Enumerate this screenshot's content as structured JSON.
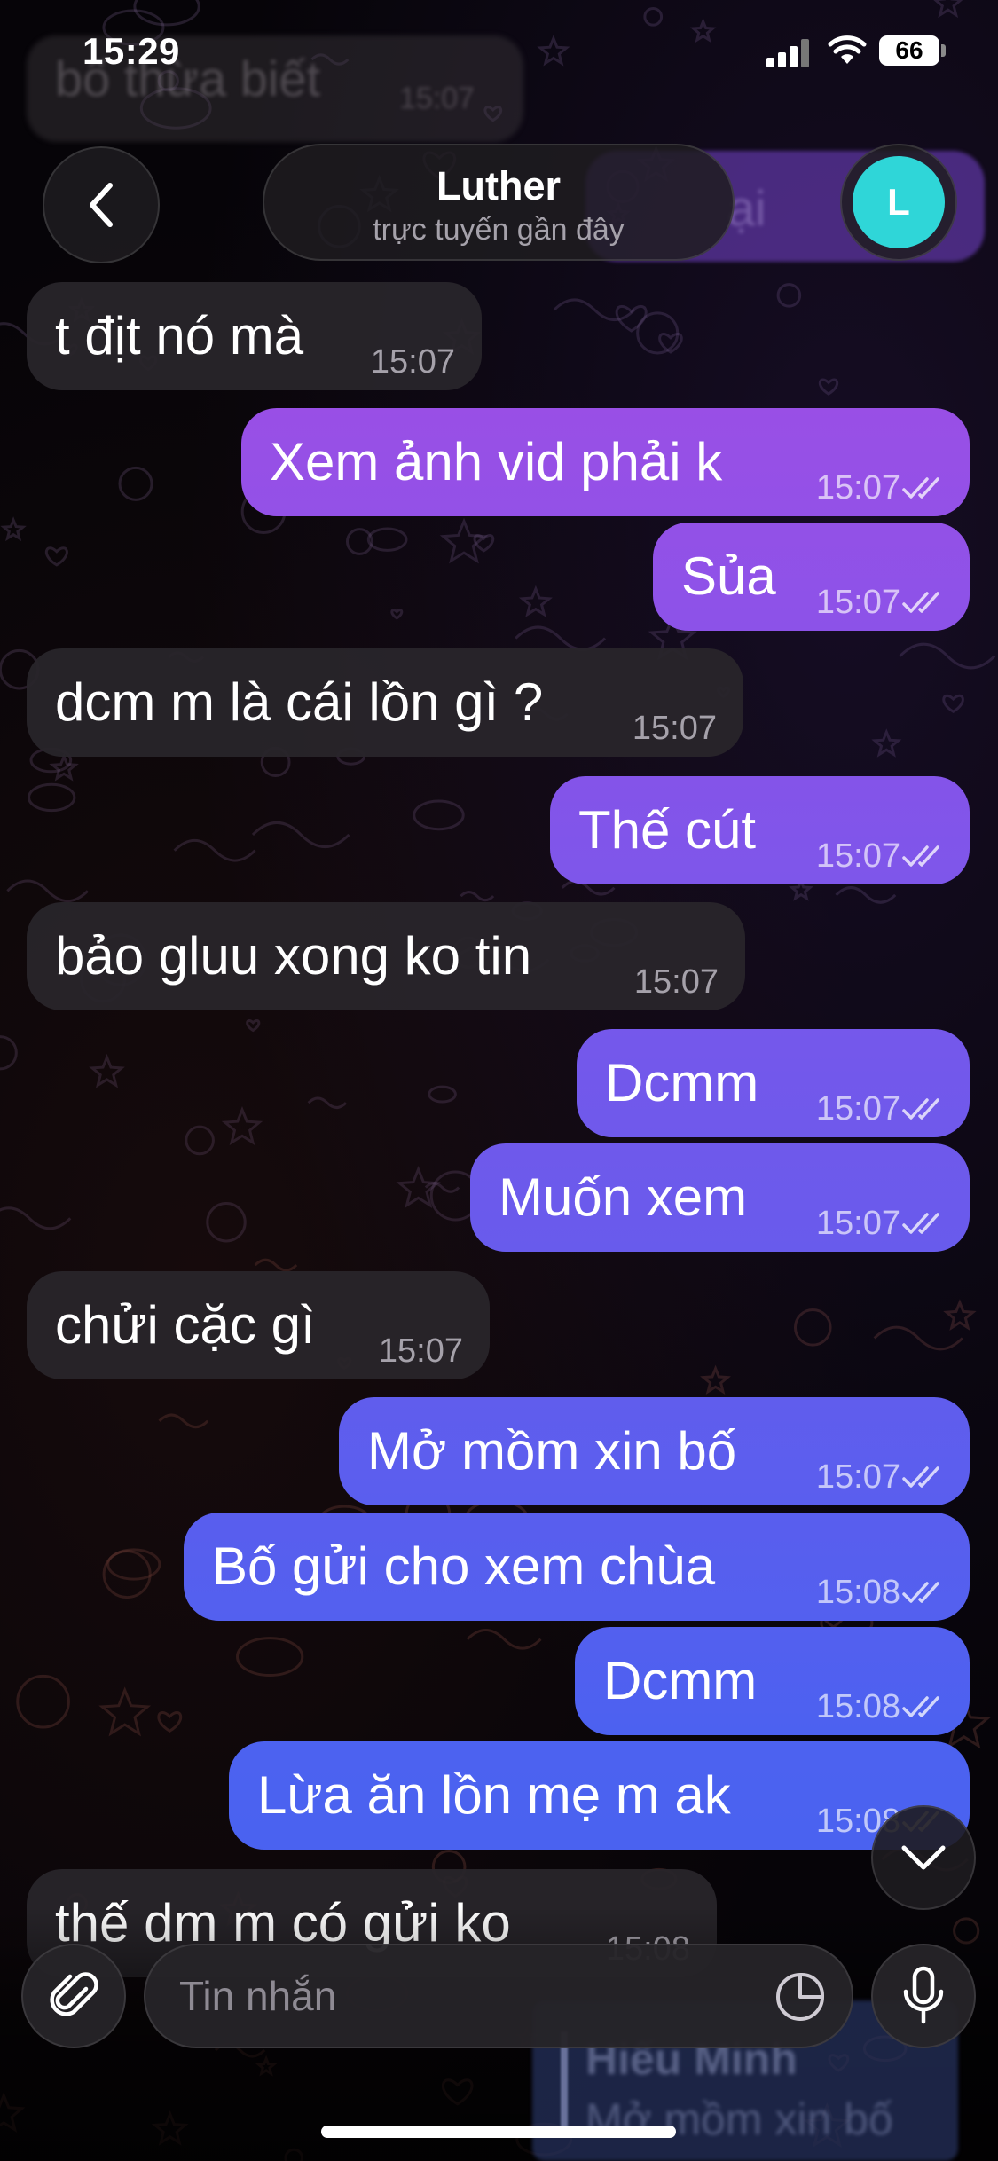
{
  "status_bar": {
    "time": "15:29",
    "battery": "66"
  },
  "background": {
    "ghost_top_text": "bố thừa biết",
    "ghost_top_time": "15:07",
    "ghost_purple_text": "ại",
    "ghost_bottom_name": "Hiếu Minh",
    "ghost_bottom_text": "Mở mồm xin bố"
  },
  "header": {
    "contact_name": "Luther",
    "contact_status": "trực tuyến gần đây",
    "avatar_letter": "L",
    "avatar_color": "#2fd6d8"
  },
  "messages": [
    {
      "dir": "in",
      "text": "t địt nó mà",
      "time": "15:07"
    },
    {
      "dir": "out",
      "text": "Xem ảnh vid phải k",
      "time": "15:07"
    },
    {
      "dir": "out",
      "text": "Sủa",
      "time": "15:07"
    },
    {
      "dir": "in",
      "text": "dcm m là cái lồn gì ?",
      "time": "15:07"
    },
    {
      "dir": "out",
      "text": "Thế cút",
      "time": "15:07"
    },
    {
      "dir": "in",
      "text": "bảo gluu xong ko tin",
      "time": "15:07"
    },
    {
      "dir": "out",
      "text": "Dcmm",
      "time": "15:07"
    },
    {
      "dir": "out",
      "text": "Muốn xem",
      "time": "15:07"
    },
    {
      "dir": "in",
      "text": "chửi cặc gì",
      "time": "15:07"
    },
    {
      "dir": "out",
      "text": "Mở mồm xin bố",
      "time": "15:07"
    },
    {
      "dir": "out",
      "text": "Bố gửi cho xem chùa",
      "time": "15:08"
    },
    {
      "dir": "out",
      "text": "Dcmm",
      "time": "15:08"
    },
    {
      "dir": "out",
      "text": "Lừa ăn lồn mẹ m ak",
      "time": "15:08"
    },
    {
      "dir": "in",
      "text": "thế dm m có gửi ko",
      "time": "15:08"
    }
  ],
  "composer": {
    "placeholder": "Tin nhắn"
  },
  "colors": {
    "outgoing_top": "#9a4fe6",
    "outgoing_bottom": "#4a62f0",
    "incoming": "#28252a"
  },
  "icons": [
    "back-chevron-icon",
    "signal-icon",
    "wifi-icon",
    "battery-icon",
    "read-ticks-icon",
    "chevron-down-icon",
    "paperclip-icon",
    "sticker-icon",
    "microphone-icon"
  ]
}
